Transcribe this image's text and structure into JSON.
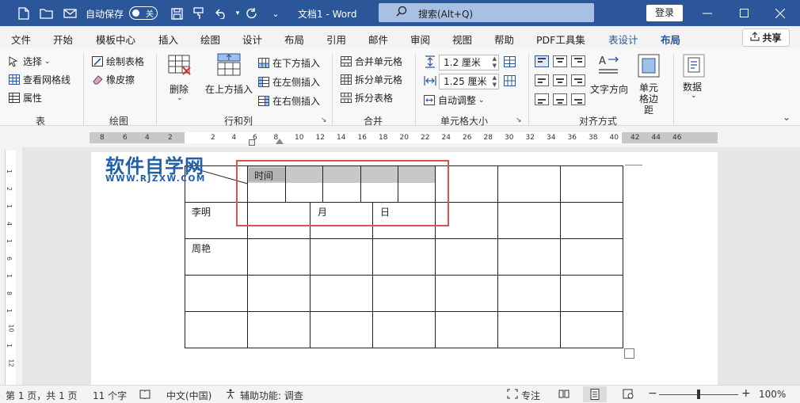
{
  "titlebar": {
    "autosave_label": "自动保存",
    "autosave_state": "关",
    "doc_title": "文档1 - Word",
    "search_placeholder": "搜索(Alt+Q)",
    "login_label": "登录"
  },
  "tabs": [
    "文件",
    "开始",
    "模板中心",
    "插入",
    "绘图",
    "设计",
    "布局",
    "引用",
    "邮件",
    "审阅",
    "视图",
    "帮助",
    "PDF工具集",
    "表设计",
    "布局"
  ],
  "share_label": "共享",
  "ribbon": {
    "table_group": {
      "select": "选择",
      "view_gridlines": "查看网格线",
      "properties": "属性",
      "label": "表"
    },
    "draw_group": {
      "draw_table": "绘制表格",
      "eraser": "橡皮擦",
      "label": "绘图"
    },
    "rows_cols_group": {
      "delete": "删除",
      "insert_above": "在上方插入",
      "insert_below": "在下方插入",
      "insert_left": "在左侧插入",
      "insert_right": "在右侧插入",
      "label": "行和列"
    },
    "merge_group": {
      "merge_cells": "合并单元格",
      "split_cells": "拆分单元格",
      "split_table": "拆分表格",
      "label": "合并"
    },
    "cell_size_group": {
      "height": "1.2 厘米",
      "width": "1.25 厘米",
      "autofit": "自动调整",
      "label": "单元格大小"
    },
    "align_group": {
      "text_direction": "文字方向",
      "cell_margins": "单元格边距",
      "label": "对齐方式"
    },
    "data_group": {
      "data": "数据"
    }
  },
  "ruler": {
    "h_left": [
      "8",
      "6",
      "4",
      "2"
    ],
    "h_mid": [
      "2",
      "4",
      "6",
      "8",
      "10",
      "12",
      "14",
      "16",
      "18",
      "20",
      "22",
      "24",
      "26",
      "28",
      "30",
      "32",
      "34",
      "36",
      "38",
      "40",
      "42",
      "44",
      "46"
    ],
    "v": [
      "1",
      "2",
      "1",
      "4",
      "1",
      "6",
      "1",
      "8",
      "1",
      "10",
      "1",
      "12"
    ]
  },
  "watermark": {
    "main": "软件自学网",
    "sub": "WWW.RJZXW.COM"
  },
  "table": {
    "time_label": "时间",
    "names": [
      "李明",
      "周艳"
    ],
    "month": "月",
    "day": "日"
  },
  "status": {
    "page": "第 1 页，共 1 页",
    "words": "11 个字",
    "language": "中文(中国)",
    "accessibility": "辅助功能: 调查",
    "focus": "专注",
    "zoom": "100%"
  }
}
